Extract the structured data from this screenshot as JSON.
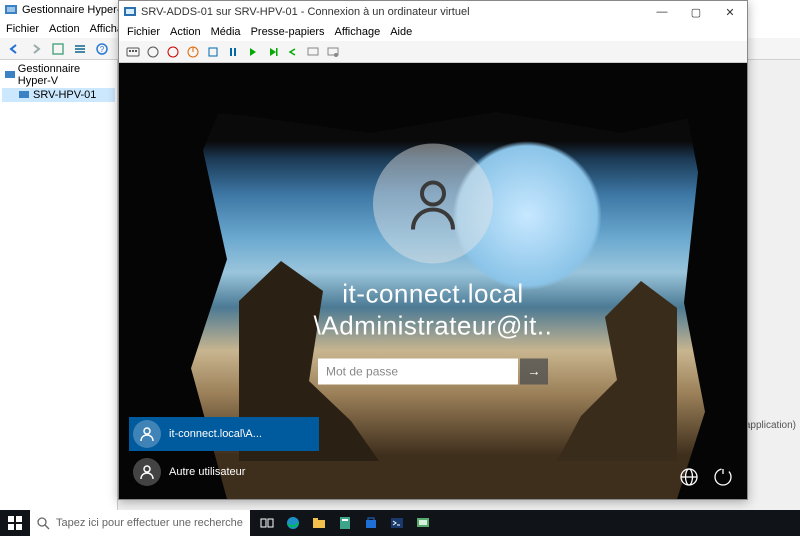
{
  "host": {
    "title": "Gestionnaire Hyper-V",
    "menu": [
      "Fichier",
      "Action",
      "Affichage",
      "?"
    ],
    "tree": {
      "root": "Gestionnaire Hyper-V",
      "node": "SRV-HPV-01"
    },
    "right_note": "(application)"
  },
  "vm": {
    "title": "SRV-ADDS-01 sur SRV-HPV-01 - Connexion à un ordinateur virtuel",
    "menu": [
      "Fichier",
      "Action",
      "Média",
      "Presse-papiers",
      "Affichage",
      "Aide"
    ],
    "winbtns": {
      "min": "—",
      "max": "▢",
      "close": "✕"
    }
  },
  "login": {
    "line1": "it-connect.local",
    "line2": "\\Administrateur@it..",
    "password_placeholder": "Mot de passe",
    "submit_glyph": "→",
    "users": [
      {
        "label": "it-connect.local\\A...",
        "selected": true
      },
      {
        "label": "Autre utilisateur",
        "selected": false
      }
    ]
  },
  "taskbar": {
    "search_placeholder": "Tapez ici pour effectuer une recherche"
  }
}
